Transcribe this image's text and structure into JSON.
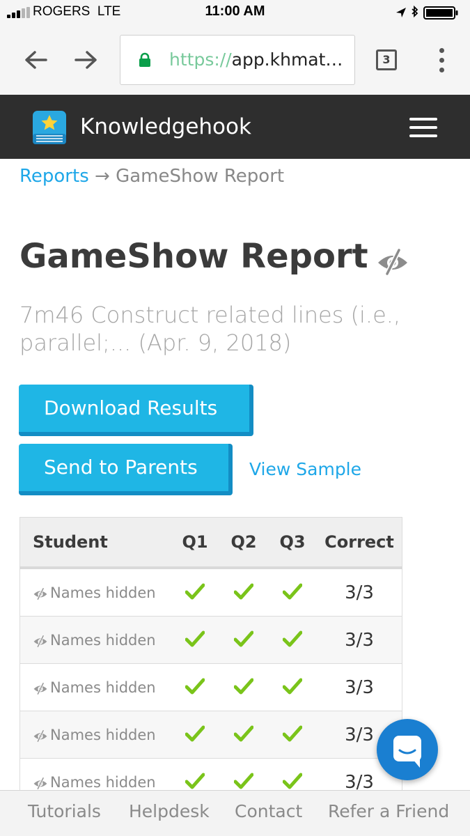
{
  "status_bar": {
    "carrier": "ROGERS",
    "network": "LTE",
    "time": "11:00 AM"
  },
  "browser": {
    "url_scheme": "https://",
    "url_host": "app.khmat…",
    "tab_count": "3"
  },
  "header": {
    "app_name": "Knowledgehook"
  },
  "breadcrumb": {
    "link": "Reports",
    "separator": " → ",
    "current": "GameShow Report"
  },
  "page": {
    "title": "GameShow Report",
    "subtitle": "7m46 Construct related lines (i.e., parallel;... (Apr. 9, 2018)"
  },
  "actions": {
    "download": "Download Results",
    "send": "Send to Parents",
    "view_sample": "View Sample"
  },
  "table": {
    "headers": {
      "student": "Student",
      "q1": "Q1",
      "q2": "Q2",
      "q3": "Q3",
      "correct": "Correct"
    },
    "rows": [
      {
        "student": "Names hidden",
        "q1": "correct",
        "q2": "correct",
        "q3": "correct",
        "correct": "3/3"
      },
      {
        "student": "Names hidden",
        "q1": "correct",
        "q2": "correct",
        "q3": "correct",
        "correct": "3/3"
      },
      {
        "student": "Names hidden",
        "q1": "correct",
        "q2": "correct",
        "q3": "correct",
        "correct": "3/3"
      },
      {
        "student": "Names hidden",
        "q1": "correct",
        "q2": "correct",
        "q3": "correct",
        "correct": "3/3"
      },
      {
        "student": "Names hidden",
        "q1": "correct",
        "q2": "correct",
        "q3": "correct",
        "correct": "3/3"
      }
    ]
  },
  "bottom_nav": {
    "tutorials": "Tutorials",
    "helpdesk": "Helpdesk",
    "contact": "Contact",
    "refer": "Refer a Friend"
  },
  "icons": {
    "check": "check-icon",
    "hidden": "eye-slash-icon",
    "chat": "chat-icon"
  },
  "colors": {
    "accent": "#1fb6e5",
    "link": "#1ea7e8",
    "check": "#7ac41a",
    "header_bg": "#2e2e2e",
    "chat": "#1a7fd1"
  }
}
